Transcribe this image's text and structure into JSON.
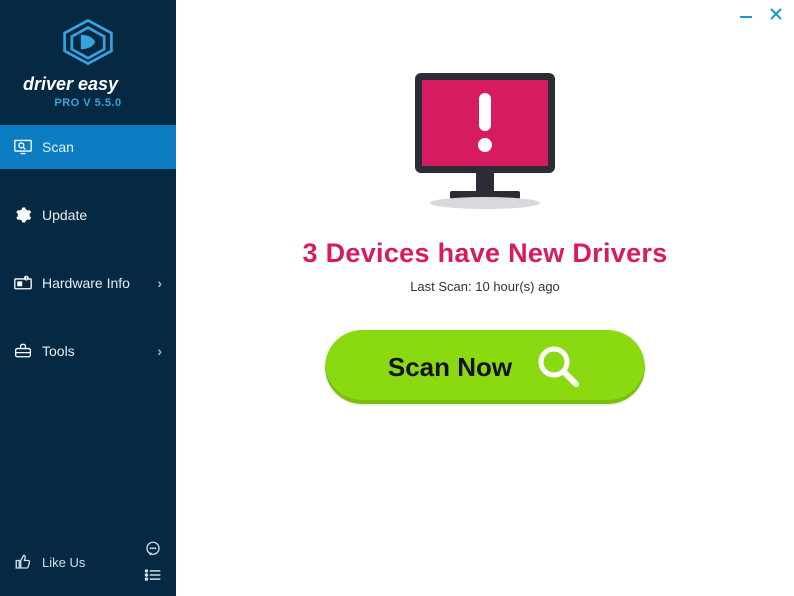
{
  "brand": {
    "name": "driver easy",
    "version": "PRO V 5.5.0"
  },
  "sidebar": {
    "items": [
      {
        "label": "Scan",
        "has_chevron": false,
        "active": true
      },
      {
        "label": "Update",
        "has_chevron": false,
        "active": false
      },
      {
        "label": "Hardware Info",
        "has_chevron": true,
        "active": false
      },
      {
        "label": "Tools",
        "has_chevron": true,
        "active": false
      }
    ],
    "like_us": "Like Us"
  },
  "main": {
    "headline": "3 Devices have New Drivers",
    "last_scan": "Last Scan: 10 hour(s) ago",
    "scan_button": "Scan Now"
  },
  "colors": {
    "sidebar_bg": "#052942",
    "sidebar_active": "#0b7cc1",
    "accent_blue": "#38a1de",
    "headline_pink": "#d81b60",
    "monitor_fill": "#d71b60",
    "scan_green": "#8bd911"
  }
}
